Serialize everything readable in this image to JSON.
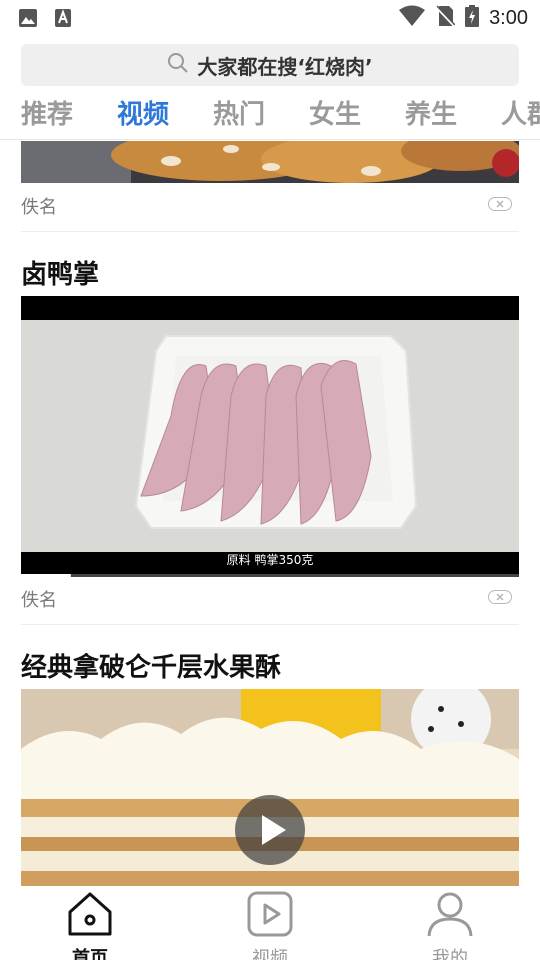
{
  "status_bar": {
    "time": "3:00",
    "left_icons": [
      "image-icon",
      "font-download-icon"
    ],
    "right_icons": [
      "wifi-icon",
      "no-sim-icon",
      "battery-charging-icon"
    ]
  },
  "search": {
    "placeholder": "大家都在搜‘红烧肉’",
    "icon": "search-icon"
  },
  "tabs": [
    {
      "label": "推荐",
      "active": false
    },
    {
      "label": "视频",
      "active": true
    },
    {
      "label": "热门",
      "active": false
    },
    {
      "label": "女生",
      "active": false
    },
    {
      "label": "养生",
      "active": false
    },
    {
      "label": "人群",
      "active": false
    }
  ],
  "feed": {
    "items": [
      {
        "title": "",
        "author": "佚名",
        "media_type": "image"
      },
      {
        "title": "卤鸭掌",
        "author": "佚名",
        "media_type": "video",
        "caption": "原料  鸭掌350克",
        "progress": 0.1
      },
      {
        "title": "经典拿破仑千层水果酥",
        "author": "",
        "media_type": "video"
      }
    ]
  },
  "bottom_nav": [
    {
      "label": "首页",
      "icon": "home-icon",
      "active": true
    },
    {
      "label": "视频",
      "icon": "video-play-icon",
      "active": false
    },
    {
      "label": "我的",
      "icon": "user-icon",
      "active": false
    }
  ],
  "colors": {
    "accent": "#2f77d8",
    "inactive_tab": "#9a9a9a"
  }
}
